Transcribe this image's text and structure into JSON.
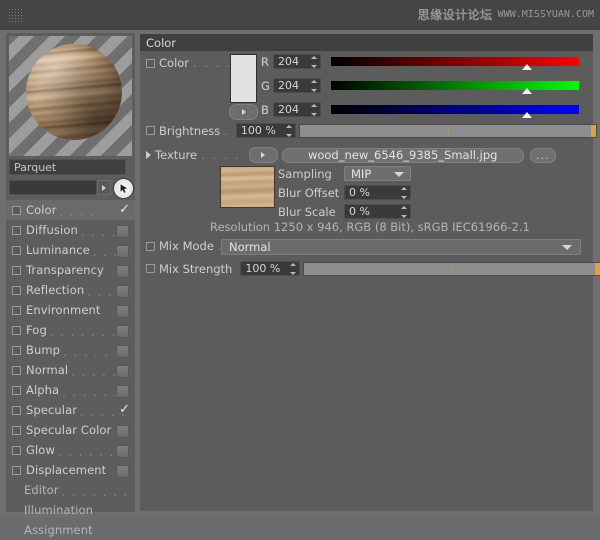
{
  "window": {
    "watermark_cn": "思缘设计论坛",
    "watermark_en": "WWW.MISSYUAN.COM"
  },
  "material": {
    "name": "Parquet",
    "search_value": "",
    "preview_name": "material-preview-sphere"
  },
  "channels": [
    {
      "label": "Color",
      "dots": ". . . .",
      "enabled": true,
      "selected": true,
      "type": "check"
    },
    {
      "label": "Diffusion",
      "dots": ". . . . .",
      "enabled": false,
      "selected": false,
      "type": "box"
    },
    {
      "label": "Luminance",
      "dots": ". . .",
      "enabled": false,
      "selected": false,
      "type": "box"
    },
    {
      "label": "Transparency",
      "dots": "",
      "enabled": false,
      "selected": false,
      "type": "box"
    },
    {
      "label": "Reflection",
      "dots": ". . . .",
      "enabled": false,
      "selected": false,
      "type": "box"
    },
    {
      "label": "Environment",
      "dots": "",
      "enabled": false,
      "selected": false,
      "type": "box"
    },
    {
      "label": "Fog",
      "dots": ". . . . . . .",
      "enabled": false,
      "selected": false,
      "type": "box"
    },
    {
      "label": "Bump",
      "dots": ". . . . . . .",
      "enabled": false,
      "selected": false,
      "type": "box"
    },
    {
      "label": "Normal",
      "dots": ". . . . .",
      "enabled": false,
      "selected": false,
      "type": "box"
    },
    {
      "label": "Alpha",
      "dots": ". . . . . . .",
      "enabled": false,
      "selected": false,
      "type": "box"
    },
    {
      "label": "Specular",
      "dots": ". . . . .",
      "enabled": true,
      "selected": false,
      "type": "check"
    },
    {
      "label": "Specular Color",
      "dots": "",
      "enabled": false,
      "selected": false,
      "type": "box"
    },
    {
      "label": "Glow",
      "dots": ". . . . . . .",
      "enabled": false,
      "selected": false,
      "type": "box"
    },
    {
      "label": "Displacement",
      "dots": "",
      "enabled": false,
      "selected": false,
      "type": "box"
    }
  ],
  "pages": [
    {
      "label": "Editor",
      "dots": ". . . . . . ."
    },
    {
      "label": "Illumination",
      "dots": ""
    },
    {
      "label": "Assignment",
      "dots": ""
    }
  ],
  "properties": {
    "group_title": "Color",
    "color": {
      "label": "Color",
      "dots": ". . . .",
      "swatch_hex": "#e2e2e2",
      "channels": [
        {
          "letter": "R",
          "value": "204",
          "percent": 80,
          "from": "#000000",
          "to": "#ff0000"
        },
        {
          "letter": "G",
          "value": "204",
          "percent": 80,
          "from": "#000000",
          "to": "#00ff00"
        },
        {
          "letter": "B",
          "value": "204",
          "percent": 80,
          "from": "#000000",
          "to": "#0000ff"
        }
      ]
    },
    "brightness": {
      "label": "Brightness",
      "dots": ".",
      "value": "100 %",
      "percent": 100
    },
    "texture": {
      "label": "Texture",
      "dots": ". . . .",
      "filename": "wood_new_6546_9385_Small.jpg",
      "browse_label": "...",
      "sampling": {
        "label": "Sampling",
        "value": "MIP"
      },
      "blur_offset": {
        "label": "Blur Offset",
        "value": "0 %"
      },
      "blur_scale": {
        "label": "Blur Scale",
        "value": "0 %"
      },
      "resolution_info": "Resolution 1250 x 946, RGB (8 Bit), sRGB IEC61966-2.1"
    },
    "mix_mode": {
      "label": "Mix Mode",
      "dots": ". .",
      "value": "Normal"
    },
    "mix_strength": {
      "label": "Mix Strength",
      "dots": "",
      "value": "100 %",
      "percent": 100
    }
  }
}
